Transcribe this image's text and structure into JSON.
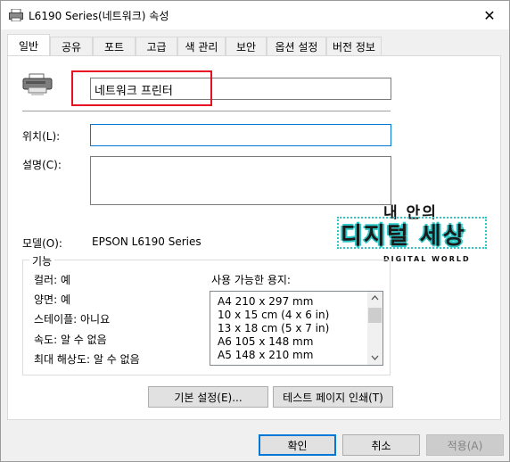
{
  "window": {
    "title": "L6190 Series(네트워크) 속성",
    "close": "✕"
  },
  "tabs": [
    "일반",
    "공유",
    "포트",
    "고급",
    "색 관리",
    "보안",
    "옵션 설정",
    "버전 정보"
  ],
  "general": {
    "printer_name": "네트워크 프린터",
    "location_label": "위치(L):",
    "location_value": "",
    "comment_label": "설명(C):",
    "comment_value": "",
    "model_label": "모델(O):",
    "model_value": "EPSON L6190 Series",
    "features": {
      "group_label": "기능",
      "color": "컬러: 예",
      "duplex": "양면: 예",
      "staple": "스테이플: 아니요",
      "speed": "속도: 알 수 없음",
      "max_res": "최대 해상도: 알 수 없음",
      "paper_label": "사용 가능한 용지:",
      "papers": [
        "A4 210 x 297 mm",
        "10 x 15 cm (4 x 6 in)",
        "13 x 18 cm (5 x 7 in)",
        "A6 105 x 148 mm",
        "A5 148 x 210 mm"
      ]
    },
    "preferences_button": "기본 설정(E)...",
    "test_page_button": "테스트 페이지 인쇄(T)"
  },
  "watermark": {
    "line1": "내 안의",
    "line2": "디지털 세상",
    "line3": "DIGITAL WORLD"
  },
  "footer": {
    "ok": "확인",
    "cancel": "취소",
    "apply": "적용(A)"
  },
  "colors": {
    "highlight_box": "#e81123",
    "focus_border": "#0078d7",
    "button_default_border": "#0078d7"
  }
}
